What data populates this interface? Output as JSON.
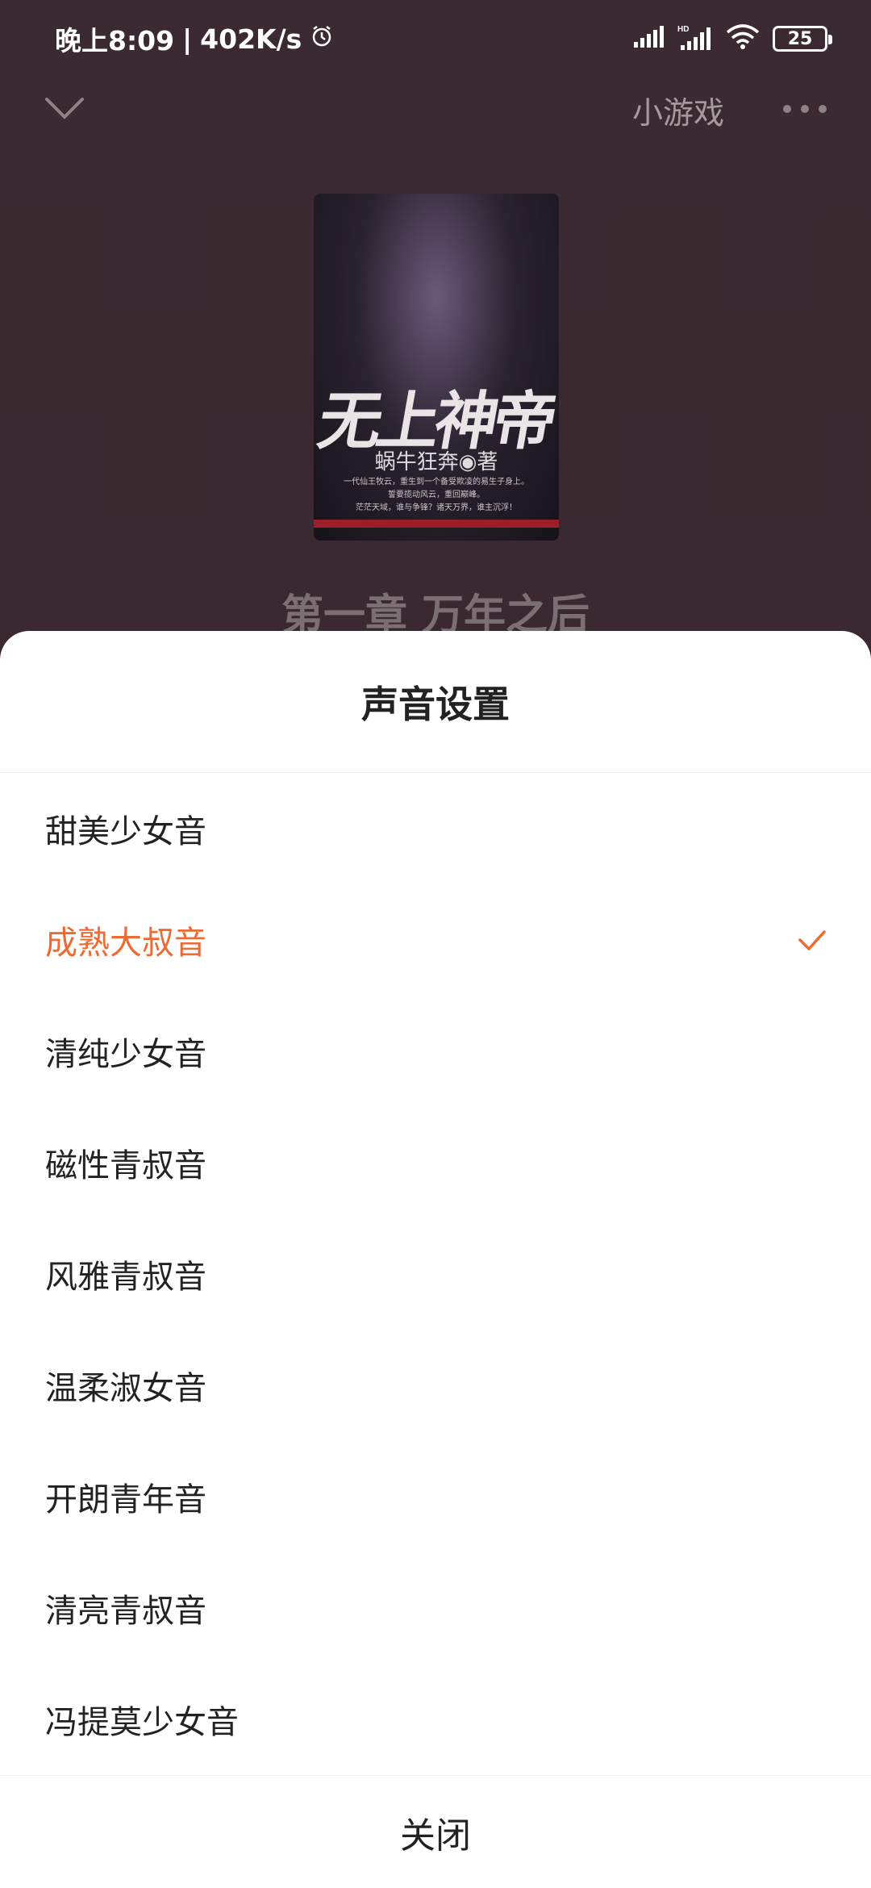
{
  "status_bar": {
    "time": "晚上8:09",
    "separator": "|",
    "speed": "402K/s",
    "battery": "25"
  },
  "nav": {
    "mini_games": "小游戏"
  },
  "cover": {
    "title": "无上神帝",
    "author": "蜗牛狂奔◉著",
    "blurb_line1": "一代仙王牧云，重生到一个备受欺凌的易生子身上。",
    "blurb_line2": "誓要揽动风云，重回巅峰。",
    "blurb_line3": "茫茫天域，谁与争锋？诸天万界，谁主沉浮！"
  },
  "chapter_title": "第一章 万年之后",
  "sheet": {
    "title": "声音设置",
    "options": [
      {
        "label": "甜美少女音",
        "selected": false
      },
      {
        "label": "成熟大叔音",
        "selected": true
      },
      {
        "label": "清纯少女音",
        "selected": false
      },
      {
        "label": "磁性青叔音",
        "selected": false
      },
      {
        "label": "风雅青叔音",
        "selected": false
      },
      {
        "label": "温柔淑女音",
        "selected": false
      },
      {
        "label": "开朗青年音",
        "selected": false
      },
      {
        "label": "清亮青叔音",
        "selected": false
      },
      {
        "label": "冯提莫少女音",
        "selected": false
      }
    ],
    "close_label": "关闭"
  },
  "colors": {
    "accent": "#ee6a33",
    "text": "#222222",
    "backdrop": "#3a2a30"
  }
}
